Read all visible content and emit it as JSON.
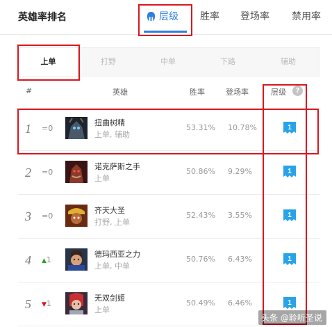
{
  "header": {
    "title": "英雄率排名",
    "tabs": [
      {
        "label": "层级",
        "icon": "tier-icon",
        "active": true
      },
      {
        "label": "胜率",
        "active": false
      },
      {
        "label": "登场率",
        "active": false
      },
      {
        "label": "禁用率",
        "active": false
      }
    ]
  },
  "lanes": [
    {
      "label": "上单",
      "active": true
    },
    {
      "label": "打野",
      "active": false
    },
    {
      "label": "中单",
      "active": false
    },
    {
      "label": "下路",
      "active": false
    },
    {
      "label": "辅助",
      "active": false
    }
  ],
  "columns": {
    "rank": "#",
    "hero": "英雄",
    "winrate": "胜率",
    "pickrate": "登场率",
    "tier": "层级",
    "help": "?"
  },
  "rows": [
    {
      "rank": "1",
      "change_symbol": "=",
      "change_value": "0",
      "change_type": "eq",
      "name": "扭曲树精",
      "roles": "上单, 辅助",
      "winrate": "53.31%",
      "pickrate": "10.78%",
      "tier": "1",
      "avatar_icon": "hero-portrait-icon"
    },
    {
      "rank": "2",
      "change_symbol": "=",
      "change_value": "0",
      "change_type": "eq",
      "name": "诺克萨斯之手",
      "roles": "上单",
      "winrate": "50.86%",
      "pickrate": "9.29%",
      "tier": "1",
      "avatar_icon": "hero-portrait-icon"
    },
    {
      "rank": "3",
      "change_symbol": "=",
      "change_value": "0",
      "change_type": "eq",
      "name": "齐天大圣",
      "roles": "打野, 上单",
      "winrate": "52.43%",
      "pickrate": "3.55%",
      "tier": "1",
      "avatar_icon": "hero-portrait-icon"
    },
    {
      "rank": "4",
      "change_symbol": "▲",
      "change_value": "1",
      "change_type": "up",
      "name": "德玛西亚之力",
      "roles": "上单, 中单",
      "winrate": "50.76%",
      "pickrate": "6.43%",
      "tier": "1",
      "avatar_icon": "hero-portrait-icon"
    },
    {
      "rank": "5",
      "change_symbol": "▼",
      "change_value": "1",
      "change_type": "down",
      "name": "无双剑姬",
      "roles": "上单",
      "winrate": "50.49%",
      "pickrate": "6.46%",
      "tier": "1",
      "avatar_icon": "hero-portrait-icon"
    }
  ],
  "watermark": "头条 @聆听圣说",
  "colors": {
    "accent": "#2f7fe0",
    "tier_badge": "#29a3e8",
    "highlight_box": "#d9171f",
    "up": "#2aa52a",
    "down": "#d9171f"
  }
}
